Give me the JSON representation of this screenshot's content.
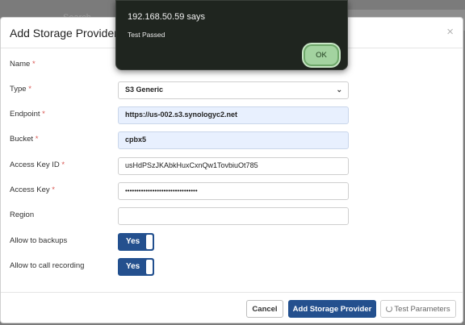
{
  "background": {
    "search_placeholder": "Search"
  },
  "alert": {
    "title": "192.168.50.59 says",
    "message": "Test Passed",
    "ok_label": "OK"
  },
  "modal": {
    "title": "Add Storage Provider",
    "close_glyph": "×",
    "fields": {
      "name": {
        "label": "Name",
        "required": "*",
        "value": ""
      },
      "type": {
        "label": "Type",
        "required": "*",
        "value": "S3 Generic"
      },
      "endpoint": {
        "label": "Endpoint",
        "required": "*",
        "value": "https://us-002.s3.synologyc2.net"
      },
      "bucket": {
        "label": "Bucket",
        "required": "*",
        "value": "cpbx5"
      },
      "access_key_id": {
        "label": "Access Key ID",
        "required": "*",
        "value": "usHdPSzJKAbkHuxCxnQw1TovbiuOt785"
      },
      "access_key": {
        "label": "Access Key",
        "required": "*",
        "value": "••••••••••••••••••••••••••••••••"
      },
      "region": {
        "label": "Region",
        "value": ""
      }
    },
    "toggles": {
      "backups": {
        "label": "Allow to backups",
        "value": "Yes"
      },
      "call_recording": {
        "label": "Allow to call recording",
        "value": "Yes"
      }
    },
    "footer": {
      "cancel_label": "Cancel",
      "add_label": "Add Storage Provider",
      "test_label": "Test Parameters"
    }
  },
  "colors": {
    "primary": "#24508e",
    "required": "#d9534f",
    "autofill": "#e8f0fe",
    "alert_bg": "#1f251f",
    "alert_ok": "#a3d3a0"
  }
}
